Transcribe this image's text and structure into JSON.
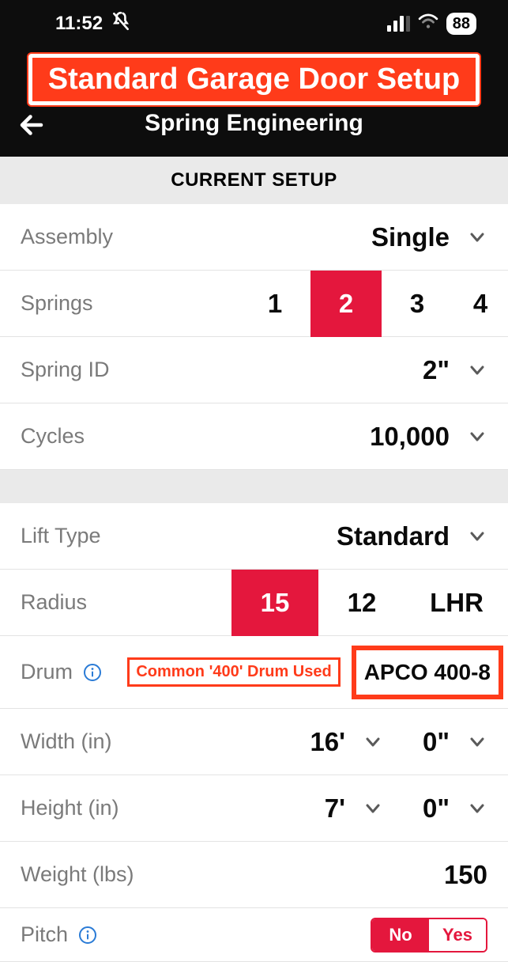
{
  "status": {
    "time": "11:52",
    "battery": "88"
  },
  "header": {
    "highlight": "Standard Garage Door Setup",
    "title": "Spring Engineering"
  },
  "section_title": "CURRENT SETUP",
  "rows": {
    "assembly": {
      "label": "Assembly",
      "value": "Single"
    },
    "springs": {
      "label": "Springs",
      "options": [
        "1",
        "2",
        "3",
        "4"
      ],
      "selected": "2"
    },
    "spring_id": {
      "label": "Spring ID",
      "value": "2\""
    },
    "cycles": {
      "label": "Cycles",
      "value": "10,000"
    },
    "lift_type": {
      "label": "Lift Type",
      "value": "Standard"
    },
    "radius": {
      "label": "Radius",
      "options": [
        "15",
        "12",
        "LHR"
      ],
      "selected": "15"
    },
    "drum": {
      "label": "Drum",
      "annotation": "Common '400' Drum Used",
      "value": "APCO 400-8"
    },
    "width": {
      "label": "Width (in)",
      "feet": "16'",
      "inches": "0\""
    },
    "height": {
      "label": "Height (in)",
      "feet": "7'",
      "inches": "0\""
    },
    "weight": {
      "label": "Weight (lbs)",
      "value": "150"
    },
    "pitch": {
      "label": "Pitch",
      "options": {
        "no": "No",
        "yes": "Yes"
      },
      "selected": "No"
    }
  }
}
